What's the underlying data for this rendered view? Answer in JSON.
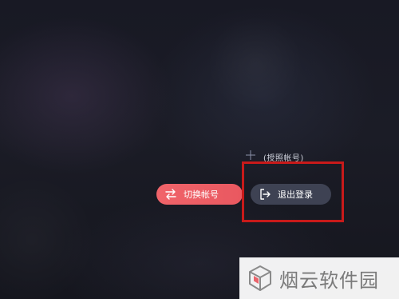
{
  "account_label": "(授照帐号)",
  "buttons": {
    "switch_account": {
      "label": "切换帐号",
      "icon": "swap-arrows-icon",
      "color": "#EE5F66"
    },
    "logout": {
      "label": "退出登录",
      "icon": "logout-icon",
      "color": "#3E4253"
    }
  },
  "annotation": {
    "highlight_color": "#C81A1A"
  },
  "watermark": {
    "text": "烟云软件园",
    "icon": "cube-logo-icon"
  }
}
